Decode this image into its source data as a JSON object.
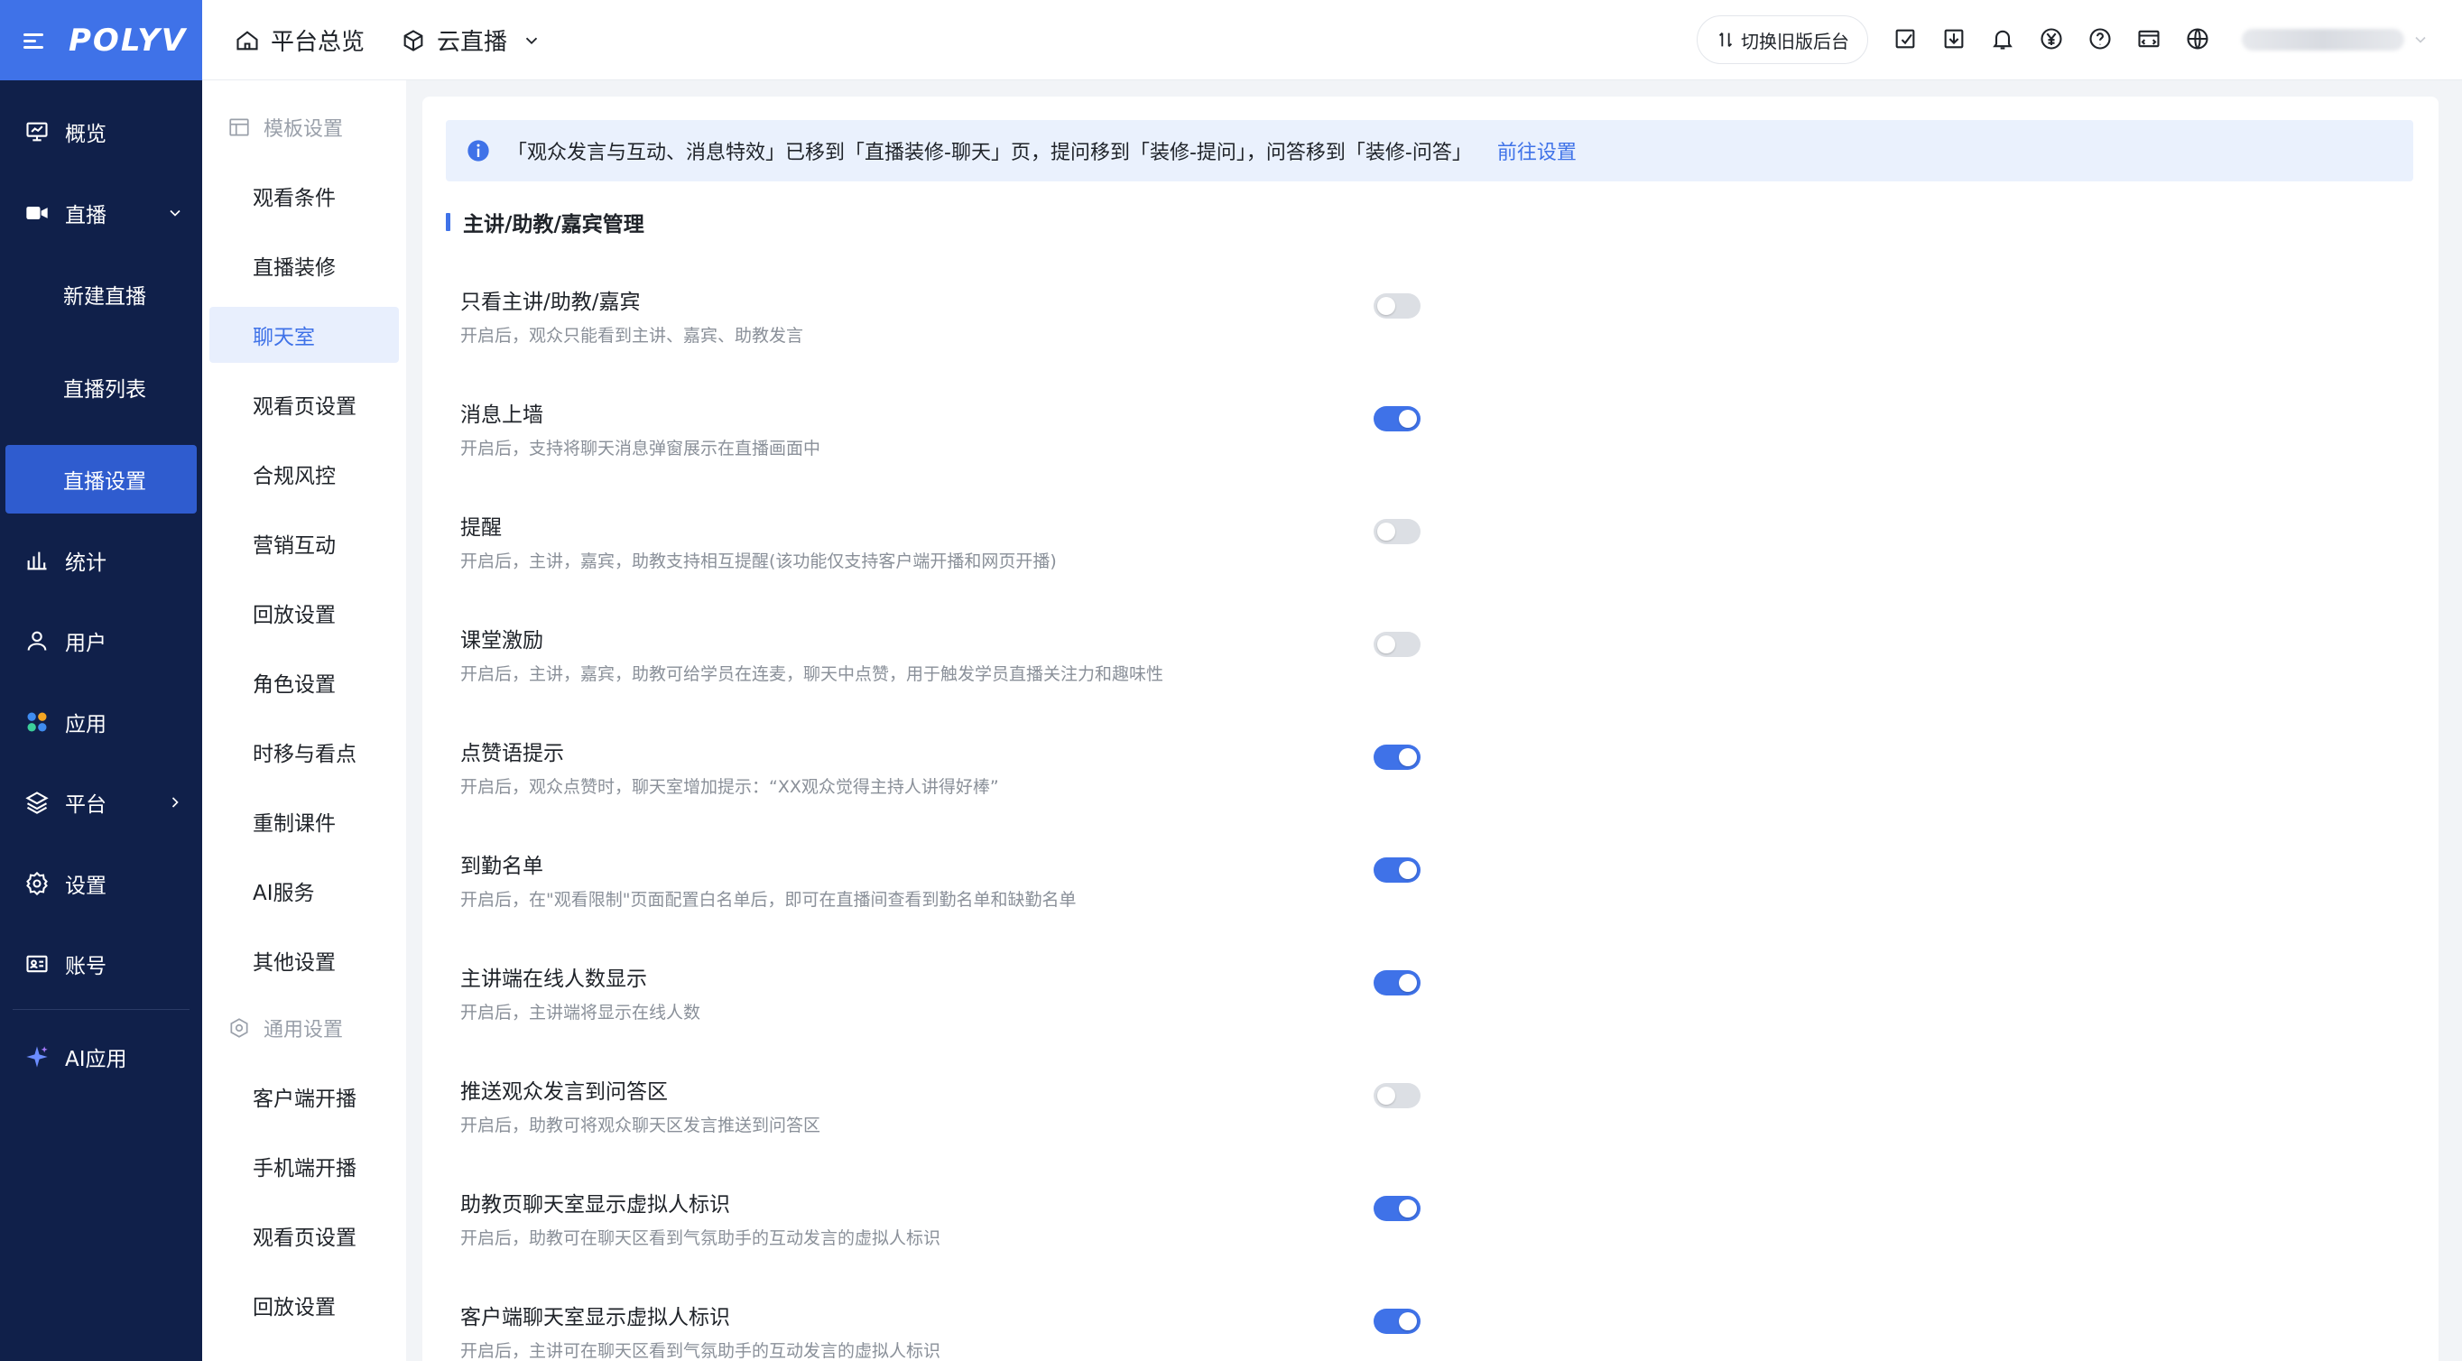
{
  "brand": {
    "logo_text": "POLYV",
    "accent": "#3f72e8",
    "sidebar_bg": "#10204a"
  },
  "sidebar": {
    "items": [
      {
        "label": "概览",
        "icon": "monitor-icon"
      },
      {
        "label": "直播",
        "icon": "video-camera-icon",
        "expanded": true
      },
      {
        "label": "新建直播"
      },
      {
        "label": "直播列表"
      },
      {
        "label": "直播设置",
        "active": true
      },
      {
        "label": "统计",
        "icon": "bar-chart-icon"
      },
      {
        "label": "用户",
        "icon": "user-icon"
      },
      {
        "label": "应用",
        "icon": "apps-icon"
      },
      {
        "label": "平台",
        "icon": "layers-icon"
      },
      {
        "label": "设置",
        "icon": "gear-icon"
      },
      {
        "label": "账号",
        "icon": "id-card-icon"
      },
      {
        "label": "AI应用",
        "icon": "sparkle-icon"
      }
    ]
  },
  "header": {
    "home_label": "平台总览",
    "product_label": "云直播",
    "switch_label": "切换旧版后台",
    "icons": [
      "edit-icon",
      "download-icon",
      "bell-icon",
      "yen-icon",
      "help-icon",
      "code-window-icon",
      "globe-icon"
    ]
  },
  "submenu": {
    "group1": "模板设置",
    "items1": [
      "观看条件",
      "直播装修",
      "聊天室",
      "观看页设置",
      "合规风控",
      "营销互动",
      "回放设置",
      "角色设置",
      "时移与看点",
      "重制课件",
      "AI服务",
      "其他设置"
    ],
    "active": "聊天室",
    "group2": "通用设置",
    "items2": [
      "客户端开播",
      "手机端开播",
      "观看页设置",
      "回放设置"
    ]
  },
  "notice": {
    "text": "「观众发言与互动、消息特效」已移到「直播装修-聊天」页，提问移到「装修-提问」，问答移到「装修-问答」",
    "link": "前往设置"
  },
  "section_title": "主讲/助教/嘉宾管理",
  "settings": [
    {
      "title": "只看主讲/助教/嘉宾",
      "desc": "开启后，观众只能看到主讲、嘉宾、助教发言",
      "on": false
    },
    {
      "title": "消息上墙",
      "desc": "开启后，支持将聊天消息弹窗展示在直播画面中",
      "on": true
    },
    {
      "title": "提醒",
      "desc": "开启后，主讲，嘉宾，助教支持相互提醒(该功能仅支持客户端开播和网页开播)",
      "on": false
    },
    {
      "title": "课堂激励",
      "desc": "开启后，主讲，嘉宾，助教可给学员在连麦，聊天中点赞，用于触发学员直播关注力和趣味性",
      "on": false
    },
    {
      "title": "点赞语提示",
      "desc": "开启后，观众点赞时，聊天室增加提示：“XX观众觉得主持人讲得好棒”",
      "on": true
    },
    {
      "title": "到勤名单",
      "desc": "开启后，在\"观看限制\"页面配置白名单后，即可在直播间查看到勤名单和缺勤名单",
      "on": true
    },
    {
      "title": "主讲端在线人数显示",
      "desc": "开启后，主讲端将显示在线人数",
      "on": true
    },
    {
      "title": "推送观众发言到问答区",
      "desc": "开启后，助教可将观众聊天区发言推送到问答区",
      "on": false
    },
    {
      "title": "助教页聊天室显示虚拟人标识",
      "desc": "开启后，助教可在聊天区看到气氛助手的互动发言的虚拟人标识",
      "on": true
    },
    {
      "title": "客户端聊天室显示虚拟人标识",
      "desc": "开启后，主讲可在聊天区看到气氛助手的互动发言的虚拟人标识",
      "on": true
    }
  ]
}
